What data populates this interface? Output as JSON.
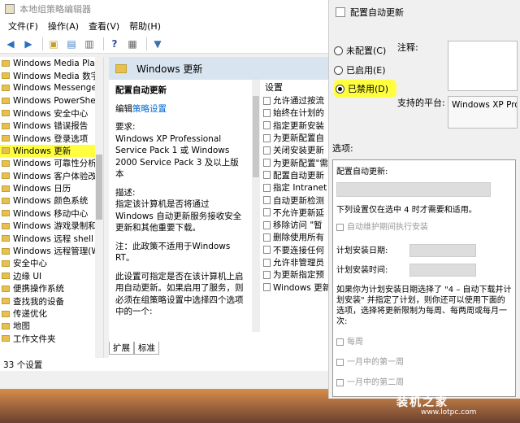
{
  "window": {
    "title": "本地组策略编辑器"
  },
  "menu": [
    "文件(F)",
    "操作(A)",
    "查看(V)",
    "帮助(H)"
  ],
  "tree": {
    "items": [
      "Windows Media Playe",
      "Windows Media 数字权",
      "Windows Messenger",
      "Windows PowerShell",
      "Windows 安全中心",
      "Windows 错误报告",
      "Windows 登录选项",
      "Windows 更新",
      "Windows 可靠性分析",
      "Windows 客户体验改善",
      "Windows 日历",
      "Windows 颜色系统",
      "Windows 移动中心",
      "Windows 游戏录制和广",
      "Windows 远程 shell",
      "Windows 远程管理(Wi",
      "安全中心",
      "边缘 UI",
      "便携操作系统",
      "查找我的设备",
      "传递优化",
      "地图",
      "工作文件夹"
    ],
    "selected": "Windows 更新"
  },
  "detail": {
    "header": "Windows 更新",
    "title": "配置自动更新",
    "edit_prefix": "编辑",
    "edit_link": "策略设置",
    "req_label": "要求:",
    "req_text": "Windows XP Professional Service Pack 1 或 Windows 2000 Service Pack 3 及以上版本",
    "desc_label": "描述:",
    "desc_text": "指定该计算机是否将通过Windows 自动更新服务接收安全更新和其他重要下载。",
    "note": "注：此政策不适用于Windows RT。",
    "more": "此设置可指定是否在该计算机上启用自动更新。如果启用了服务，则必须在组策略设置中选择四个选项中的一个:"
  },
  "settings_list": {
    "header": "设置",
    "items": [
      "允许通过按流",
      "始终在计划的",
      "指定更新安装",
      "为更新配置自",
      "关闭安装更新",
      "为更新配置\"需",
      "配置自动更新",
      "指定 Intranet",
      "自动更新检测",
      "不允许更新延",
      "移除访问 \"暂",
      "删除使用所有",
      "不要连接任何",
      "允许非管理员",
      "为更新指定预",
      "Windows 更新"
    ]
  },
  "tabs": [
    "扩展",
    "标准"
  ],
  "status": "33 个设置",
  "dialog": {
    "title": "配置自动更新",
    "radios": [
      {
        "label": "未配置(C)",
        "checked": false
      },
      {
        "label": "已启用(E)",
        "checked": false
      },
      {
        "label": "已禁用(D)",
        "checked": true
      }
    ],
    "comment_label": "注释:",
    "platform_label": "支持的平台:",
    "platform_value": "Windows XP Profe",
    "options_label": "选项:",
    "opts": {
      "config_label": "配置自动更新:",
      "note": "下列设置仅在选中 4 时才需要和适用。",
      "maint_label": "自动维护期间执行安装",
      "day_label": "计划安装日期:",
      "time_label": "计划安装时间:",
      "long_text": "如果你为计划安装日期选择了 \"4 – 自动下载并计划安装\" 并指定了计划，则你还可以使用下面的选项，选择将更新限制为每周、每两周或每月一次:",
      "weekly": "每周",
      "first_week": "一月中的第一周",
      "second_week": "一月中的第二周"
    }
  },
  "watermark": {
    "main": "装机之家",
    "sub": "www.lotpc.com"
  }
}
